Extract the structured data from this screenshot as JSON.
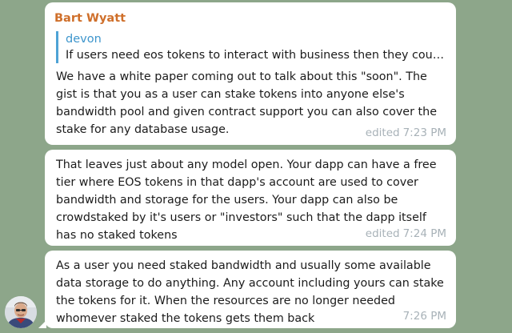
{
  "messages": [
    {
      "sender": "Bart Wyatt",
      "reply": {
        "author": "devon",
        "text": "If users need eos tokens to interact with business then they coul…"
      },
      "text": "We have a white paper coming out to talk about this \"soon\".  The gist is that you as a user can stake tokens into anyone else's bandwidth pool and given contract support you can also cover the stake for any database usage.",
      "edited_label": "edited",
      "time": "7:23 PM"
    },
    {
      "text": "That leaves just about any model open.  Your dapp can have a free tier where EOS tokens in that dapp's account are used to cover bandwidth and storage for the users.  Your dapp can also be crowdstaked by it's users or \"investors\" such that the dapp itself has no staked tokens",
      "edited_label": "edited",
      "time": "7:24 PM"
    },
    {
      "text": "As a user you need staked bandwidth and usually some available data storage to do anything.  Any account including yours can stake the tokens for it.  When the resources are no longer needed whomever staked the tokens gets them back",
      "time": "7:26 PM"
    }
  ],
  "colors": {
    "background": "#8da68a",
    "sender": "#cf6f2a",
    "reply_accent": "#4ea3d6",
    "meta": "#a8b2b8"
  },
  "avatar": {
    "icon": "user-avatar-icon"
  }
}
